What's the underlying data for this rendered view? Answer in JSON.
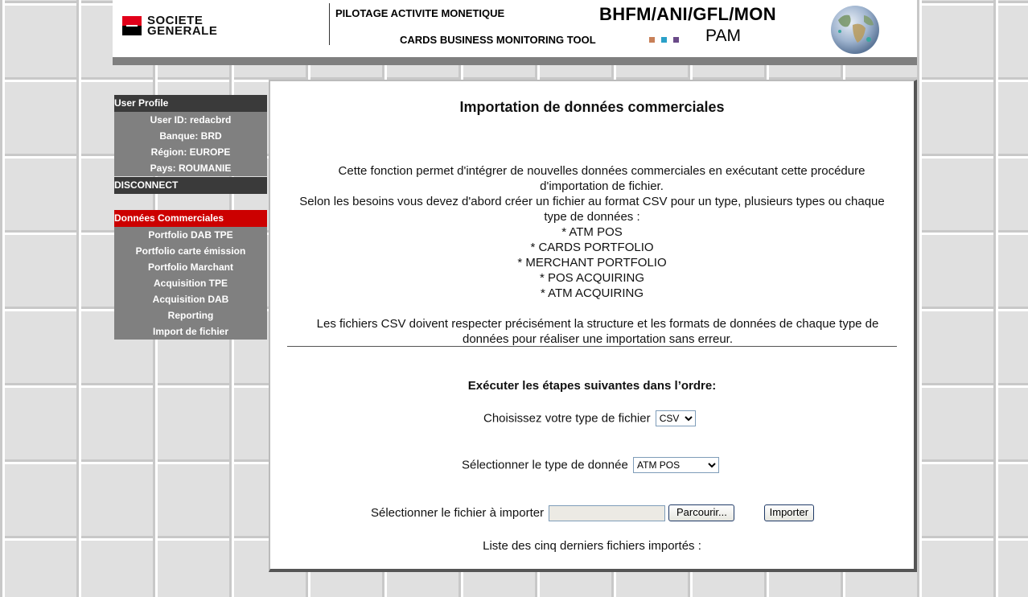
{
  "header": {
    "logo_text": "SOCIETE GENERALE",
    "title_line1": "PILOTAGE ACTIVITE MONETIQUE",
    "title_line2": "CARDS BUSINESS MONITORING TOOL",
    "code": "BHFM/ANI/GFL/MON",
    "app_short": "PAM",
    "dot_colors": [
      "#c88058",
      "#2aa0c8",
      "#6a4a88"
    ]
  },
  "sidebar": {
    "profile_title": "User Profile",
    "profile_items": [
      "User ID: redacbrd",
      "Banque: BRD",
      "Région: EUROPE",
      "Pays: ROUMANIE"
    ],
    "disconnect": "DISCONNECT",
    "section_title": "Données Commerciales",
    "menu_items": [
      "Portfolio DAB TPE",
      "Portfolio carte émission",
      "Portfolio Marchant",
      "Acquisition TPE",
      "Acquisition DAB",
      "Reporting",
      "Import de fichier"
    ]
  },
  "main": {
    "title": "Importation de données commerciales",
    "intro_line1": "Cette fonction permet d'intégrer de nouvelles données commerciales en exécutant cette procédure d'importation de fichier.",
    "intro_line2": "Selon les besoins vous devez d'abord créer un fichier au format CSV pour un type, plusieurs types ou chaque type de données :",
    "data_types": [
      "* ATM POS",
      "* CARDS PORTFOLIO",
      "* MERCHANT PORTFOLIO",
      "* POS ACQUIRING",
      "* ATM ACQUIRING"
    ],
    "intro_line3": "Les fichiers CSV doivent respecter précisément la structure et les formats de données de chaque type de données pour réaliser une importation sans erreur.",
    "steps_title": "Exécuter les étapes suivantes dans l’ordre:",
    "file_type_label": "Choisissez votre type de fichier",
    "file_type_value": "CSV",
    "data_type_label": "Sélectionner le type de donnée",
    "data_type_value": "ATM POS",
    "file_label": "Sélectionner le fichier à importer",
    "file_value": "",
    "browse_button": "Parcourir...",
    "import_button": "Importer",
    "last_files_label": "Liste des cinq derniers fichiers importés :"
  }
}
